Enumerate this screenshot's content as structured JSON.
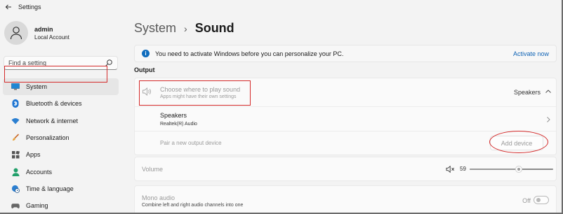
{
  "window": {
    "title": "Settings"
  },
  "profile": {
    "name": "admin",
    "account_type": "Local Account"
  },
  "search": {
    "placeholder": "Find a setting"
  },
  "sidebar": {
    "items": [
      {
        "label": "System",
        "icon": "monitor-icon",
        "active": true
      },
      {
        "label": "Bluetooth & devices",
        "icon": "bluetooth-icon"
      },
      {
        "label": "Network & internet",
        "icon": "wifi-icon"
      },
      {
        "label": "Personalization",
        "icon": "brush-icon"
      },
      {
        "label": "Apps",
        "icon": "apps-icon"
      },
      {
        "label": "Accounts",
        "icon": "person-icon"
      },
      {
        "label": "Time & language",
        "icon": "globe-clock-icon"
      },
      {
        "label": "Gaming",
        "icon": "controller-icon"
      }
    ]
  },
  "breadcrumb": {
    "parent": "System",
    "separator": "›",
    "current": "Sound"
  },
  "infobar": {
    "message": "You need to activate Windows before you can personalize your PC.",
    "link": "Activate now"
  },
  "output": {
    "section_title": "Output",
    "choose_title": "Choose where to play sound",
    "choose_subtitle": "Apps might have their own settings",
    "selected_device": "Speakers",
    "device_name": "Speakers",
    "device_driver": "Realtek(R) Audio",
    "pair_label": "Pair a new output device",
    "add_button": "Add device"
  },
  "volume": {
    "label": "Volume",
    "value": "59",
    "level": 0.59
  },
  "mono": {
    "title": "Mono audio",
    "subtitle": "Combine left and right audio channels into one",
    "state": "Off"
  },
  "colors": {
    "accent": "#0f6cbd",
    "annotation": "#d42a2a"
  }
}
